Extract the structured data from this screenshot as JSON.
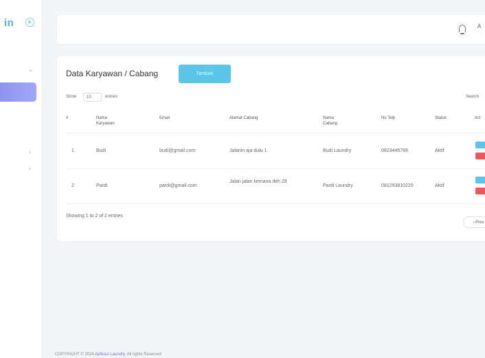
{
  "brand": {
    "name": "in"
  },
  "topbar": {
    "user": "A"
  },
  "card": {
    "title": "Data Karyawan / Cabang",
    "add_button": "Tambah"
  },
  "table_controls": {
    "show_label": "Show",
    "show_value": "10",
    "entries_label": "entries",
    "search_label": "Search"
  },
  "table": {
    "headers": [
      "#",
      "Nama Karyawan",
      "Email",
      "Alamat Cabang",
      "Nama Cabang",
      "No Telp",
      "Status",
      "Act"
    ],
    "rows": [
      {
        "no": "1",
        "name": "Budi",
        "email": "budi@gmail.com",
        "address": "Jalanin aja dulu 1",
        "branch": "Budi Laundry",
        "phone": "0823446789",
        "status": "Aktif"
      },
      {
        "no": "2",
        "name": "Pardi",
        "email": "pardi@gmail.com",
        "address": "Jalan jalan kemana deh 28",
        "branch": "Pardi Laundry",
        "phone": "081293810220",
        "status": "Aktif"
      }
    ]
  },
  "pagination": {
    "info": "Showing 1 to 2 of 2 entries",
    "prev": "‹ Prev"
  },
  "footer": {
    "prefix": "COPYRIGHT © 2024",
    "link": "Aplikasi Laundry",
    "suffix": ", All rights Reserved"
  },
  "colors": {
    "accent": "#5dc6e8",
    "danger": "#e8585d",
    "sidebar_active": "#9a9ef2",
    "background": "#f4f5f8"
  },
  "icons": {
    "brand": "gear-icon",
    "notification": "bell-icon",
    "chevron": "chevron-right-icon"
  }
}
